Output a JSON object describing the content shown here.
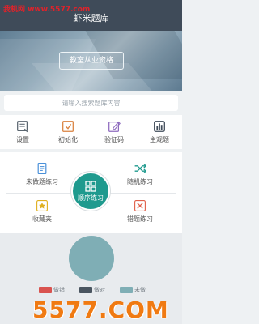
{
  "watermark_top": "我机网 www.5577.com",
  "watermark_bottom": "5577.COM",
  "header": {
    "title": "虾米题库"
  },
  "banner": {
    "button_label": "教室从业资格"
  },
  "search": {
    "placeholder": "请输入搜索题库内容"
  },
  "toolbar": {
    "items": [
      {
        "label": "设置",
        "icon": "settings-icon",
        "color": "#5b6670"
      },
      {
        "label": "初始化",
        "icon": "reset-icon",
        "color": "#d9813e"
      },
      {
        "label": "验证码",
        "icon": "edit-icon",
        "color": "#8e6bbf"
      },
      {
        "label": "主观题",
        "icon": "chart-icon",
        "color": "#3f4b59"
      }
    ]
  },
  "practice": {
    "undone": {
      "label": "未做题练习",
      "icon": "document-icon",
      "color": "#4a90d9"
    },
    "random": {
      "label": "随机练习",
      "icon": "shuffle-icon",
      "color": "#1f9a8e"
    },
    "favorites": {
      "label": "收藏夹",
      "icon": "star-icon",
      "color": "#e0b020"
    },
    "wrong": {
      "label": "错题练习",
      "icon": "wrong-icon",
      "color": "#e0604a"
    },
    "sequential": {
      "label": "顺序练习",
      "icon": "grid-icon",
      "color": "#1f9a8e"
    }
  },
  "stats": {
    "legend": [
      {
        "label": "做错",
        "color": "#d9534f"
      },
      {
        "label": "做对",
        "color": "#4a5560"
      },
      {
        "label": "未做",
        "color": "#7faeb5"
      }
    ]
  }
}
